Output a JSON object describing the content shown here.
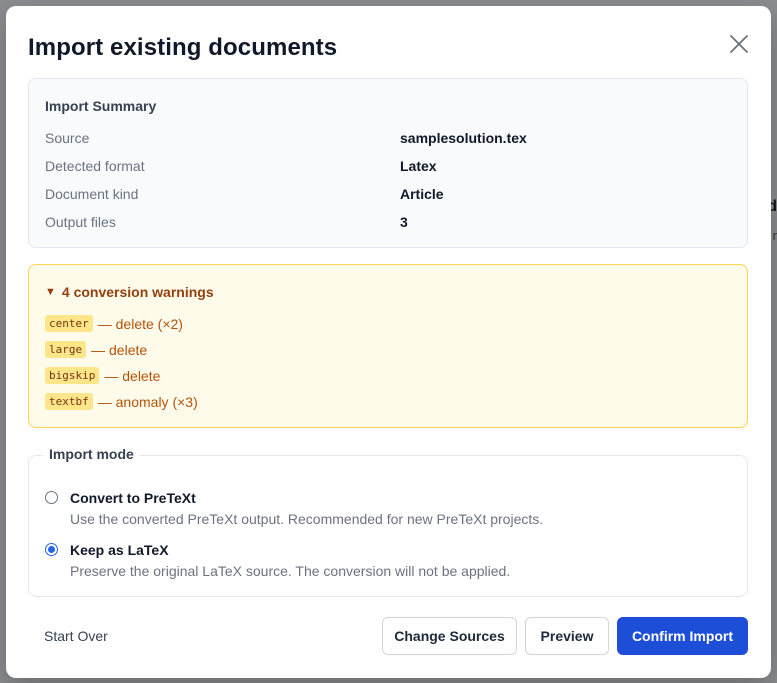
{
  "background": {
    "right_hint_1": "d",
    "right_hint_2": "r"
  },
  "dialog": {
    "title": "Import existing documents",
    "close_icon": "close-icon"
  },
  "summary": {
    "heading": "Import Summary",
    "rows": [
      {
        "label": "Source",
        "value": "samplesolution.tex"
      },
      {
        "label": "Detected format",
        "value": "Latex"
      },
      {
        "label": "Document kind",
        "value": "Article"
      },
      {
        "label": "Output files",
        "value": "3"
      }
    ]
  },
  "warnings": {
    "toggle_glyph": "▼",
    "summary": "4 conversion warnings",
    "items": [
      {
        "code": "center",
        "text": "— delete (×2)"
      },
      {
        "code": "large",
        "text": "— delete"
      },
      {
        "code": "bigskip",
        "text": "— delete"
      },
      {
        "code": "textbf",
        "text": "— anomaly (×3)"
      }
    ]
  },
  "mode": {
    "legend": "Import mode",
    "options": [
      {
        "title": "Convert to PreTeXt",
        "description": "Use the converted PreTeXt output. Recommended for new PreTeXt projects.",
        "checked": false
      },
      {
        "title": "Keep as LaTeX",
        "description": "Preserve the original LaTeX source. The conversion will not be applied.",
        "checked": true
      }
    ]
  },
  "footer": {
    "start_over": "Start Over",
    "change_sources": "Change Sources",
    "preview": "Preview",
    "confirm": "Confirm Import"
  },
  "colors": {
    "primary": "#1d4ed8",
    "warning_bg": "#fffbeb",
    "warning_border": "#fcd34d",
    "warning_text": "#b45309",
    "overlay": "#8b8d90"
  }
}
